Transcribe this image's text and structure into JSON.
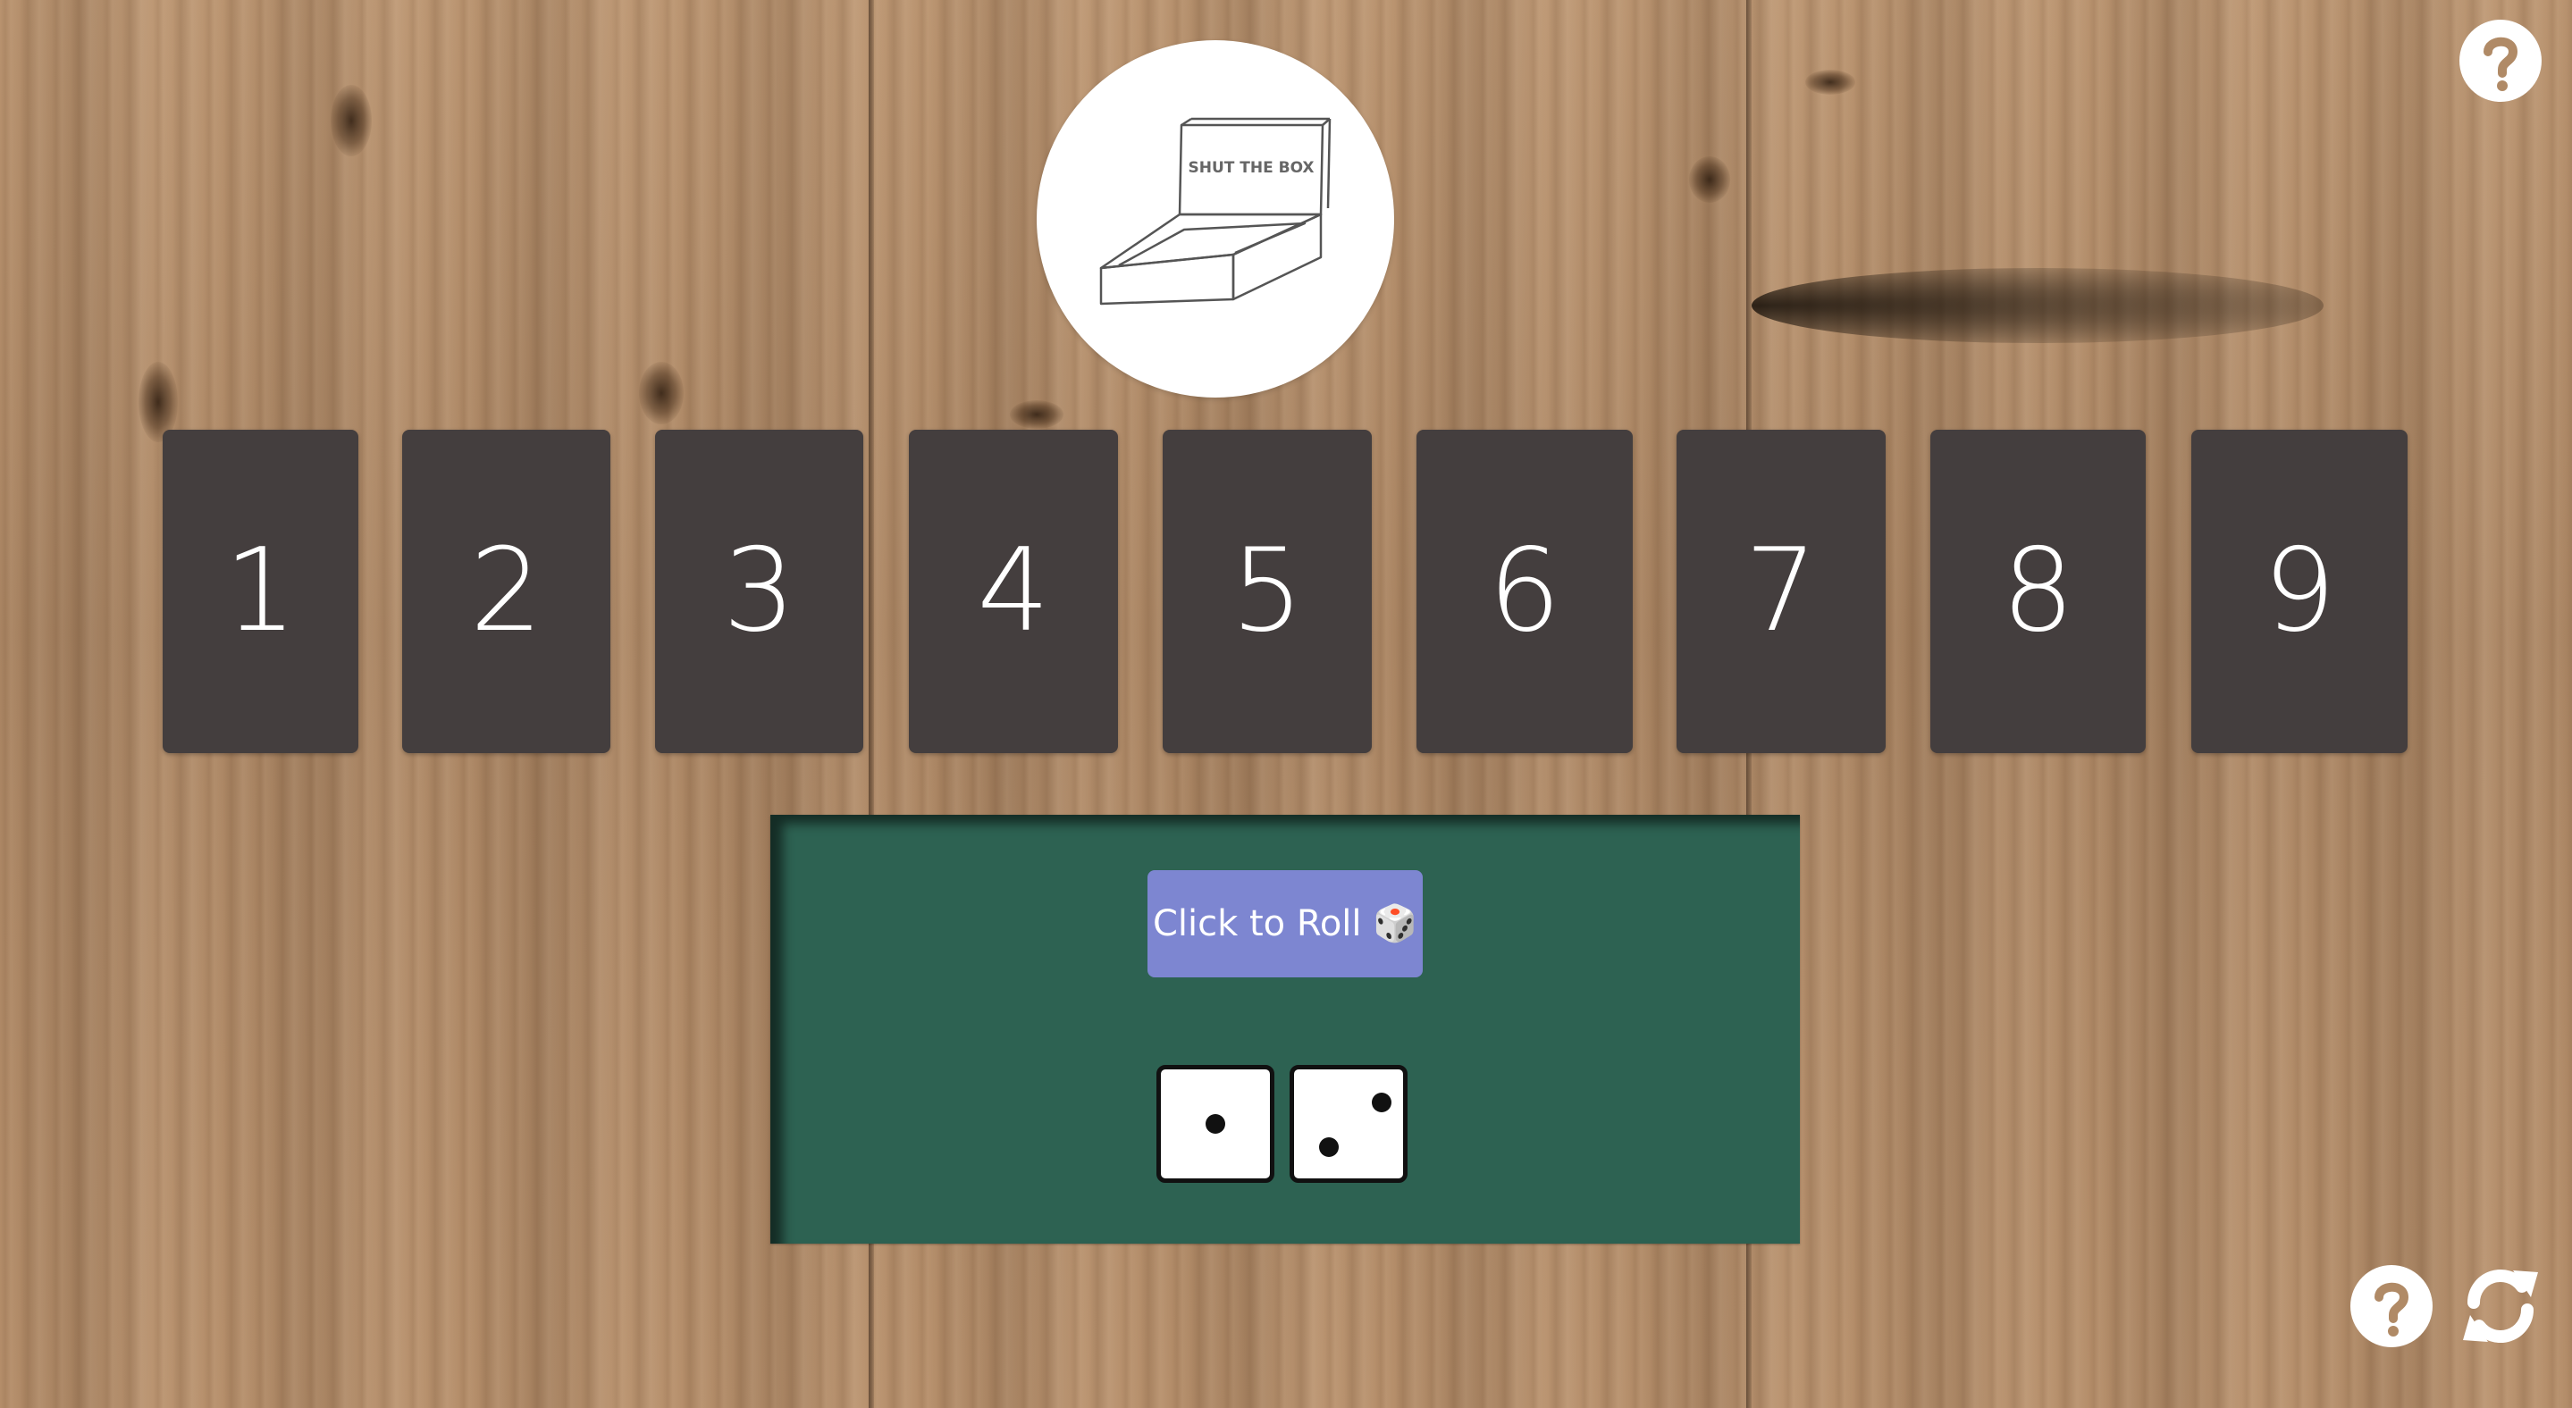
{
  "logo": {
    "text": "SHUT THE BOX"
  },
  "tiles": [
    {
      "label": "1"
    },
    {
      "label": "2"
    },
    {
      "label": "3"
    },
    {
      "label": "4"
    },
    {
      "label": "5"
    },
    {
      "label": "6"
    },
    {
      "label": "7"
    },
    {
      "label": "8"
    },
    {
      "label": "9"
    }
  ],
  "roll_button": {
    "label": "Click to Roll 🎲"
  },
  "dice": [
    {
      "value": 1
    },
    {
      "value": 2
    }
  ],
  "icons": {
    "help_top": "question-circle-icon",
    "help_bottom": "question-circle-icon",
    "restart": "refresh-icon"
  },
  "colors": {
    "tile": "#443e3e",
    "tray": "#2d6252",
    "roll_button": "#7d86d1",
    "icon": "#ffffff"
  }
}
